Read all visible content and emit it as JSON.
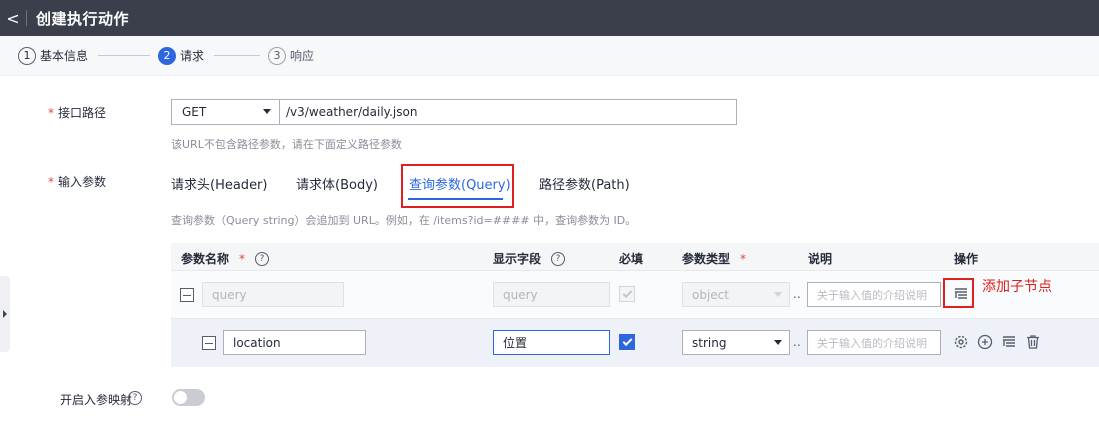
{
  "header": {
    "title": "创建执行动作",
    "back_glyph": "<"
  },
  "steps": [
    {
      "num": "1",
      "label": "基本信息",
      "state": "done"
    },
    {
      "num": "2",
      "label": "请求",
      "state": "active"
    },
    {
      "num": "3",
      "label": "响应",
      "state": "future"
    }
  ],
  "path": {
    "label": "接口路径",
    "method": "GET",
    "url": "/v3/weather/daily.json",
    "hint": "该URL不包含路径参数，请在下面定义路径参数"
  },
  "params": {
    "label": "输入参数",
    "tabs": [
      "请求头(Header)",
      "请求体(Body)",
      "查询参数(Query)",
      "路径参数(Path)"
    ],
    "active_tab": 2,
    "hint": "查询参数（Query string）会追加到 URL。例如，在 /items?id=#### 中，查询参数为 ID。"
  },
  "table": {
    "columns": [
      "参数名称",
      "显示字段",
      "必填",
      "参数类型",
      "说明",
      "操作"
    ],
    "rows": [
      {
        "name": "query",
        "display": "query",
        "required": false,
        "type": "object",
        "desc_placeholder": "关于输入值的介绍说明"
      },
      {
        "name": "location",
        "display": "位置",
        "required": true,
        "type": "string",
        "desc_placeholder": "关于输入值的介绍说明"
      }
    ]
  },
  "annotation": "添加子节点",
  "mapping": {
    "label": "开启入参映射",
    "enabled": false
  },
  "icons": {
    "help": "question-circle-icon",
    "add_child": "add-child-node-icon",
    "settings": "gear-icon",
    "add": "plus-circle-icon",
    "delete": "trash-icon"
  },
  "colors": {
    "primary": "#2d67e0",
    "required": "#e54545",
    "annotation": "#e02020",
    "header_bg": "#3a3f4b"
  }
}
